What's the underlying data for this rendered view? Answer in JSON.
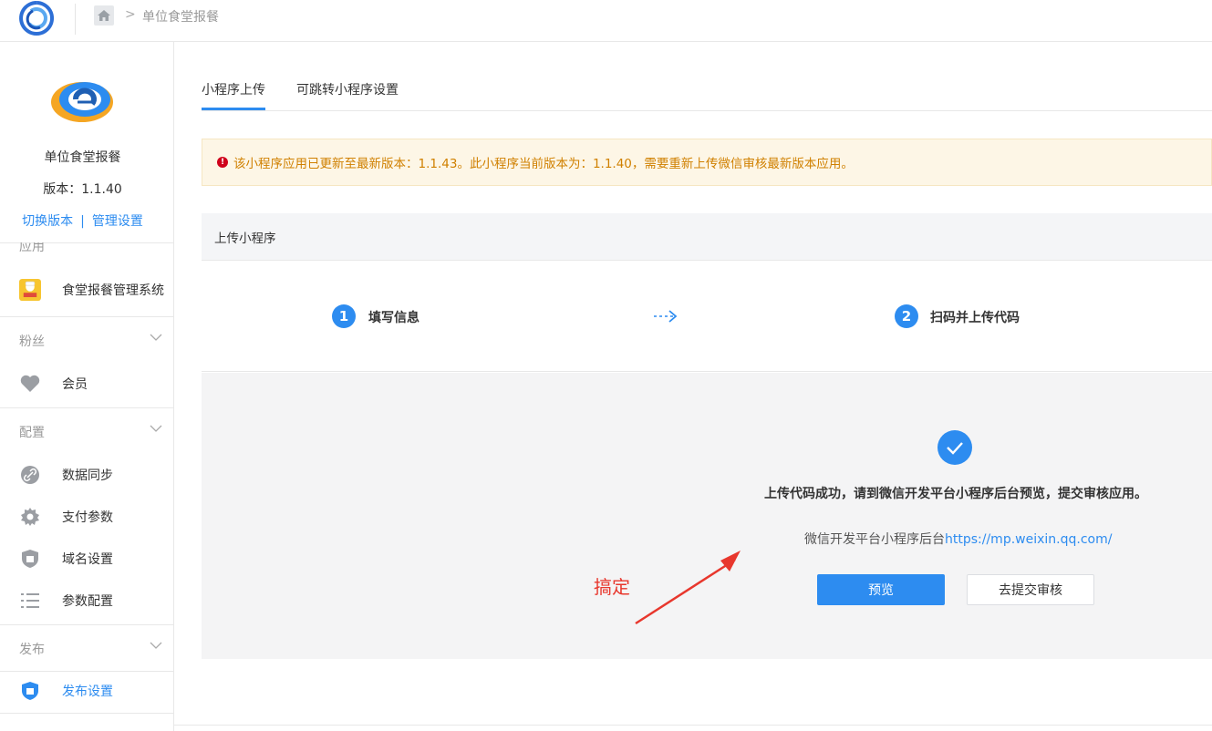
{
  "breadcrumb": {
    "current": "单位食堂报餐"
  },
  "app": {
    "name": "单位食堂报餐",
    "version": "版本：1.1.40",
    "switch_version": "切换版本",
    "separator": "|",
    "manage_settings": "管理设置"
  },
  "sidebar": {
    "section_app": "应用",
    "app_item": "食堂报餐管理系统",
    "section_fans": "粉丝",
    "member": "会员",
    "section_config": "配置",
    "config_items": [
      "数据同步",
      "支付参数",
      "域名设置",
      "参数配置"
    ],
    "section_publish": "发布",
    "publish_settings": "发布设置"
  },
  "tabs": [
    "小程序上传",
    "可跳转小程序设置"
  ],
  "alert": {
    "text": "该小程序应用已更新至最新版本：1.1.43。此小程序当前版本为：1.1.40，需要重新上传微信审核最新版本应用。"
  },
  "card": {
    "title": "上传小程序"
  },
  "steps": [
    {
      "num": "1",
      "label": "填写信息"
    },
    {
      "num": "2",
      "label": "扫码并上传代码"
    }
  ],
  "result": {
    "title": "上传代码成功，请到微信开发平台小程序后台预览，提交审核应用。",
    "link_prefix": "微信开发平台小程序后台",
    "link_url": "https://mp.weixin.qq.com/",
    "preview_button": "预览",
    "submit_button": "去提交审核"
  },
  "annotation": {
    "text": "搞定"
  },
  "colors": {
    "accent": "#2d8cf0",
    "warning": "#d08000",
    "annotation": "#e8372d"
  }
}
